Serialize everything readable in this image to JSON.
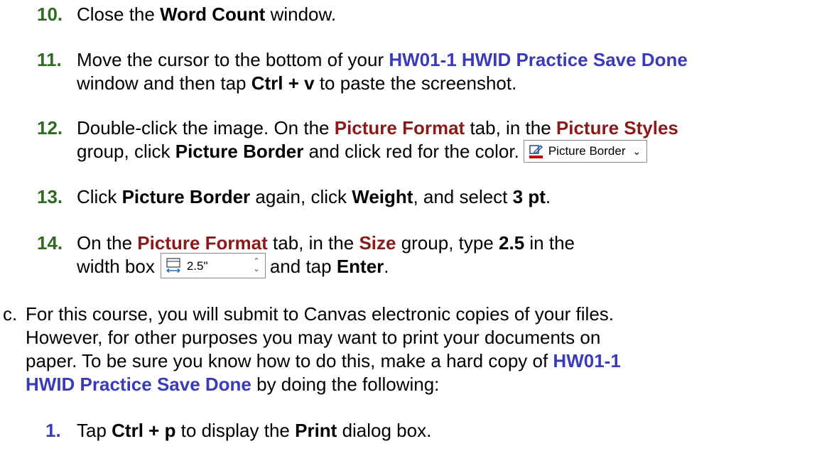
{
  "step10": {
    "num": "10.",
    "t1": "Close the ",
    "b1": "Word Count",
    "t2": " window."
  },
  "step11": {
    "num": "11.",
    "t1": "Move the cursor to the bottom of your ",
    "doc": "HW01-1 HWID Practice Save Done",
    "t2": "window and then tap ",
    "key": "Ctrl + v",
    "t3": " to paste the screenshot."
  },
  "step12": {
    "num": "12.",
    "t1": "Double-click the image. On the ",
    "tab": "Picture Format",
    "t2": " tab, in the ",
    "group": "Picture Styles",
    "t3": "group, click ",
    "cmd": "Picture Border",
    "t4": " and click red for the color.",
    "button_label": "Picture Border",
    "button_icon": "pen-border-icon",
    "accent_red": "#c00000"
  },
  "step13": {
    "num": "13.",
    "t1": "Click ",
    "b1": "Picture Border",
    "t2": " again, click ",
    "b2": "Weight",
    "t3": ", and select ",
    "b3": "3 pt",
    "t4": "."
  },
  "step14": {
    "num": "14.",
    "t1": "On the ",
    "tab": "Picture Format",
    "t2": " tab, in the ",
    "group": "Size",
    "t3": " group, type ",
    "val": "2.5",
    "t4": " in the",
    "t5": "width box",
    "box_value": "2.5\"",
    "t6": "and tap ",
    "key": "Enter",
    "t7": "."
  },
  "stepc": {
    "label": "c.",
    "l1": "For this course, you will submit to Canvas electronic copies of your files.",
    "l2": "However, for other purposes you may want to print your documents on",
    "l3": "paper. To be sure you know how to do this, make a hard copy of ",
    "doc1": "HW01-1",
    "doc2": "HWID Practice Save Done",
    "l4": " by doing the following:"
  },
  "step1": {
    "num": "1.",
    "t1": "Tap ",
    "key": "Ctrl + p",
    "t2": " to display the ",
    "b1": "Print",
    "t3": " dialog box."
  },
  "colors": {
    "green": "#2e6b1f",
    "blue": "#3a3bb8",
    "darkred": "#8b1a1a"
  }
}
